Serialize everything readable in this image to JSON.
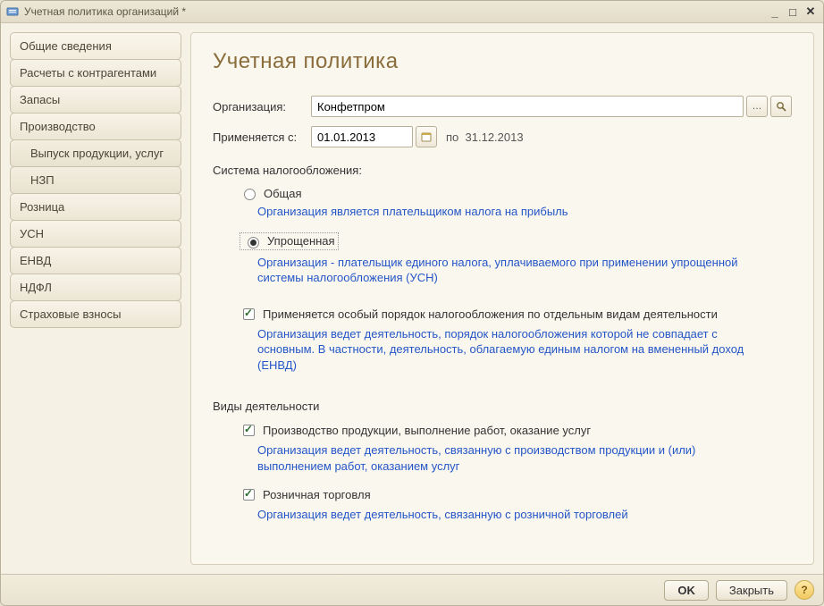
{
  "window": {
    "title": "Учетная политика организаций *"
  },
  "sidebar": {
    "items": [
      {
        "label": "Общие сведения",
        "selected": true
      },
      {
        "label": "Расчеты с контрагентами"
      },
      {
        "label": "Запасы"
      },
      {
        "label": "Производство"
      },
      {
        "label": "Выпуск продукции, услуг",
        "sub": true
      },
      {
        "label": "НЗП",
        "sub": true
      },
      {
        "label": "Розница"
      },
      {
        "label": "УСН"
      },
      {
        "label": "ЕНВД"
      },
      {
        "label": "НДФЛ"
      },
      {
        "label": "Страховые взносы"
      }
    ]
  },
  "page": {
    "title": "Учетная политика",
    "org_label": "Организация:",
    "org_value": "Конфетпром",
    "applies_label": "Применяется с:",
    "date_from": "01.01.2013",
    "date_to_prefix": "по",
    "date_to": "31.12.2013",
    "tax_system_label": "Система налогообложения:",
    "options": {
      "general": {
        "label": "Общая",
        "hint": "Организация является плательщиком налога на прибыль"
      },
      "simplified": {
        "label": "Упрощенная",
        "hint": "Организация - плательщик единого налога, уплачиваемого при применении упрощенной системы налогообложения (УСН)"
      }
    },
    "special": {
      "label": "Применяется особый порядок налогообложения по отдельным видам деятельности",
      "hint": "Организация ведет деятельность, порядок налогообложения которой не совпадает с основным. В частности, деятельность, облагаемую единым налогом на вмененный доход (ЕНВД)"
    },
    "activities_label": "Виды деятельности",
    "activities": {
      "production": {
        "label": "Производство  продукции, выполнение работ, оказание услуг",
        "hint": "Организация ведет деятельность, связанную с производством продукции и (или) выполнением работ, оказанием услуг"
      },
      "retail": {
        "label": "Розничная торговля",
        "hint": "Организация ведет деятельность, связанную с розничной торговлей"
      }
    }
  },
  "footer": {
    "ok": "OK",
    "close": "Закрыть"
  }
}
